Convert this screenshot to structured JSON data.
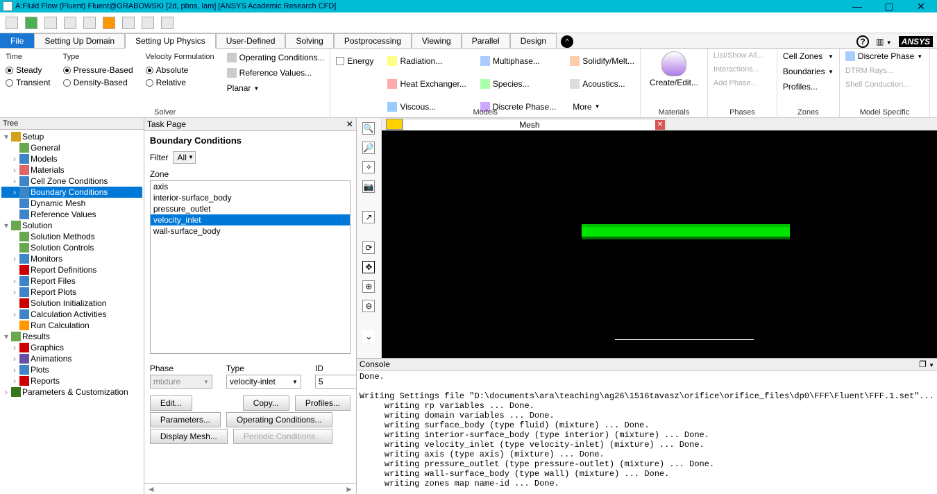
{
  "titlebar": {
    "title": "A:Fluid Flow (Fluent) Fluent@GRABOWSKI  [2d, pbns, lam]  [ANSYS Academic Research CFD]"
  },
  "menutabs": [
    "File",
    "Setting Up Domain",
    "Setting Up Physics",
    "User-Defined",
    "Solving",
    "Postprocessing",
    "Viewing",
    "Parallel",
    "Design"
  ],
  "activeTab": "Setting Up Physics",
  "ribbon": {
    "solver": {
      "time_hdr": "Time",
      "type_hdr": "Type",
      "vel_hdr": "Velocity Formulation",
      "steady": "Steady",
      "transient": "Transient",
      "pressure": "Pressure-Based",
      "density": "Density-Based",
      "absolute": "Absolute",
      "relative": "Relative",
      "operating": "Operating Conditions...",
      "reference": "Reference Values...",
      "planar": "Planar",
      "group": "Solver"
    },
    "models": {
      "energy": "Energy",
      "radiation": "Radiation...",
      "heatex": "Heat Exchanger...",
      "viscous": "Viscous...",
      "multiphase": "Multiphase...",
      "species": "Species...",
      "discrete": "Discrete Phase...",
      "solidify": "Solidify/Melt...",
      "acoustics": "Acoustics...",
      "more": "More",
      "group": "Models"
    },
    "materials": {
      "create": "Create/Edit...",
      "group": "Materials"
    },
    "phases": {
      "list": "List/Show All...",
      "interactions": "Interactions...",
      "addphase": "Add Phase...",
      "group": "Phases"
    },
    "zones": {
      "cell": "Cell Zones",
      "boundaries": "Boundaries",
      "profiles": "Profiles...",
      "group": "Zones"
    },
    "modelspec": {
      "discrete": "Discrete Phase",
      "dtrm": "DTRM Rays...",
      "shell": "Shell Conduction...",
      "group": "Model Specific"
    }
  },
  "tree": {
    "hdr": "Tree",
    "nodes": [
      {
        "lvl": 0,
        "tw": "▾",
        "ic": "#d4a017",
        "label": "Setup"
      },
      {
        "lvl": 1,
        "tw": "",
        "ic": "#6aa84f",
        "label": "General"
      },
      {
        "lvl": 1,
        "tw": "›",
        "ic": "#3d85c6",
        "label": "Models"
      },
      {
        "lvl": 1,
        "tw": "›",
        "ic": "#e06666",
        "label": "Materials"
      },
      {
        "lvl": 1,
        "tw": "›",
        "ic": "#3d85c6",
        "label": "Cell Zone Conditions"
      },
      {
        "lvl": 1,
        "tw": "›",
        "ic": "#3d85c6",
        "label": "Boundary Conditions",
        "sel": true
      },
      {
        "lvl": 1,
        "tw": "",
        "ic": "#3d85c6",
        "label": "Dynamic Mesh"
      },
      {
        "lvl": 1,
        "tw": "",
        "ic": "#3d85c6",
        "label": "Reference Values"
      },
      {
        "lvl": 0,
        "tw": "▾",
        "ic": "#6aa84f",
        "label": "Solution"
      },
      {
        "lvl": 1,
        "tw": "",
        "ic": "#6aa84f",
        "label": "Solution Methods"
      },
      {
        "lvl": 1,
        "tw": "",
        "ic": "#6aa84f",
        "label": "Solution Controls"
      },
      {
        "lvl": 1,
        "tw": "›",
        "ic": "#3d85c6",
        "label": "Monitors"
      },
      {
        "lvl": 1,
        "tw": "",
        "ic": "#cc0000",
        "label": "Report Definitions"
      },
      {
        "lvl": 1,
        "tw": "›",
        "ic": "#3d85c6",
        "label": "Report Files"
      },
      {
        "lvl": 1,
        "tw": "›",
        "ic": "#3d85c6",
        "label": "Report Plots"
      },
      {
        "lvl": 1,
        "tw": "",
        "ic": "#cc0000",
        "label": "Solution Initialization"
      },
      {
        "lvl": 1,
        "tw": "›",
        "ic": "#3d85c6",
        "label": "Calculation Activities"
      },
      {
        "lvl": 1,
        "tw": "",
        "ic": "#ff9900",
        "label": "Run Calculation"
      },
      {
        "lvl": 0,
        "tw": "▾",
        "ic": "#6aa84f",
        "label": "Results"
      },
      {
        "lvl": 1,
        "tw": "›",
        "ic": "#cc0000",
        "label": "Graphics"
      },
      {
        "lvl": 1,
        "tw": "›",
        "ic": "#674ea7",
        "label": "Animations"
      },
      {
        "lvl": 1,
        "tw": "›",
        "ic": "#3d85c6",
        "label": "Plots"
      },
      {
        "lvl": 1,
        "tw": "›",
        "ic": "#cc0000",
        "label": "Reports"
      },
      {
        "lvl": 0,
        "tw": "›",
        "ic": "#38761d",
        "label": "Parameters & Customization"
      }
    ]
  },
  "taskpage": {
    "hdr": "Task Page",
    "title": "Boundary Conditions",
    "filter": "Filter",
    "filterval": "All",
    "zone": "Zone",
    "zones": [
      "axis",
      "interior-surface_body",
      "pressure_outlet",
      "velocity_inlet",
      "wall-surface_body"
    ],
    "selected": "velocity_inlet",
    "phase": "Phase",
    "type": "Type",
    "id": "ID",
    "phaseval": "mixture",
    "typeval": "velocity-inlet",
    "idval": "5",
    "edit": "Edit...",
    "copy": "Copy...",
    "profiles": "Profiles...",
    "parameters": "Parameters...",
    "opcond": "Operating Conditions...",
    "displaymesh": "Display Mesh...",
    "periodic": "Periodic Conditions..."
  },
  "viewport": {
    "meshLabel": "Mesh"
  },
  "console": {
    "hdr": "Console",
    "text": "Done.\n\nWriting Settings file \"D:\\documents\\ara\\teaching\\ag26\\1516tavasz\\orifice\\orifice_files\\dp0\\FFF\\Fluent\\FFF.1.set\"...\n     writing rp variables ... Done.\n     writing domain variables ... Done.\n     writing surface_body (type fluid) (mixture) ... Done.\n     writing interior-surface_body (type interior) (mixture) ... Done.\n     writing velocity_inlet (type velocity-inlet) (mixture) ... Done.\n     writing axis (type axis) (mixture) ... Done.\n     writing pressure_outlet (type pressure-outlet) (mixture) ... Done.\n     writing wall-surface_body (type wall) (mixture) ... Done.\n     writing zones map name-id ... Done."
  },
  "ansys": "ANSYS"
}
